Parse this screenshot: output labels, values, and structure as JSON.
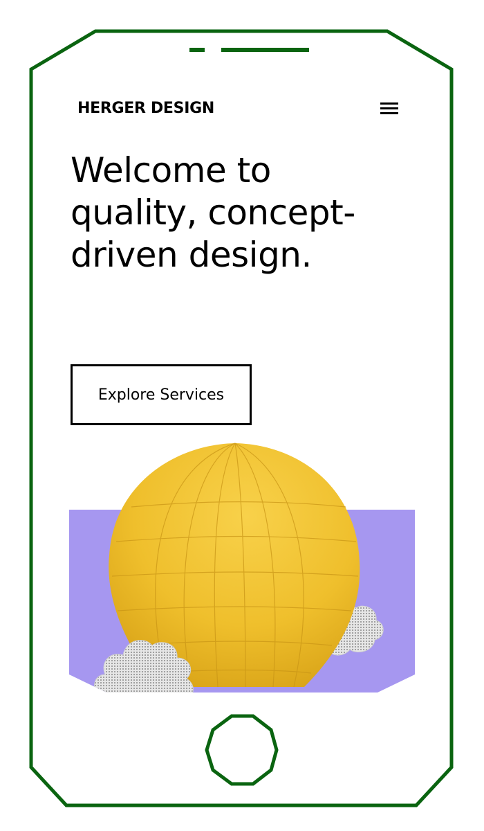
{
  "header": {
    "brand": "HERGER DESIGN",
    "menu_icon": "hamburger-menu-icon"
  },
  "hero": {
    "title": "Welcome to quality, concept-driven design.",
    "cta_label": "Explore Services",
    "image": "hot-air-balloon-with-clouds"
  },
  "colors": {
    "frame_green": "#0a6410",
    "background_band": "#a697f0",
    "balloon_yellow": "#f2c230",
    "text": "#000000"
  }
}
